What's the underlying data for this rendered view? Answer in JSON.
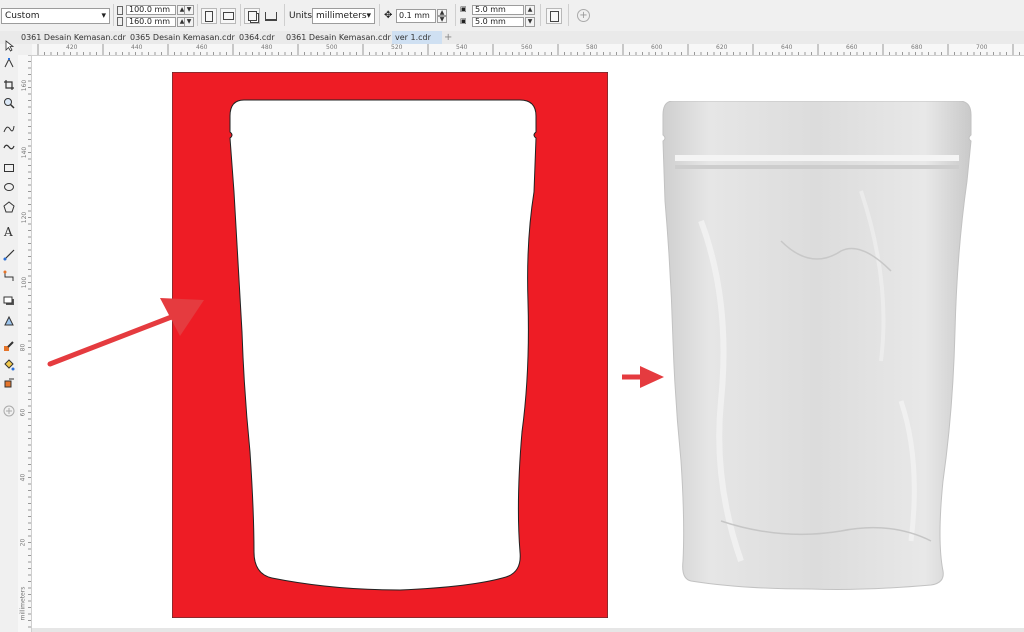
{
  "property_bar": {
    "preset": "Custom",
    "width": "100.0 mm",
    "height": "160.0 mm",
    "units_label": "Units:",
    "units_value": "millimeters",
    "nudge": "0.1 mm",
    "dup_x": "5.0 mm",
    "dup_y": "5.0 mm"
  },
  "tabs": [
    {
      "label": "0361 Desain Kemasan.cdr"
    },
    {
      "label": "0365 Desain Kemasan.cdr"
    },
    {
      "label": "0364.cdr"
    },
    {
      "label": "0361 Desain Kemasan.cdr"
    },
    {
      "label": "ver 1.cdr"
    }
  ],
  "hruler_ticks": [
    "420",
    "440",
    "460",
    "480",
    "500",
    "520",
    "540",
    "560",
    "580",
    "600",
    "620",
    "640",
    "660",
    "680",
    "700"
  ],
  "vruler_ticks": [
    "160",
    "140",
    "120",
    "100",
    "80",
    "60",
    "40",
    "20"
  ],
  "vruler_units": "millimeters",
  "colors": {
    "red_panel": "#ee1c25",
    "arrow": "#e53b3f",
    "pouch": "#d9d9d9"
  }
}
